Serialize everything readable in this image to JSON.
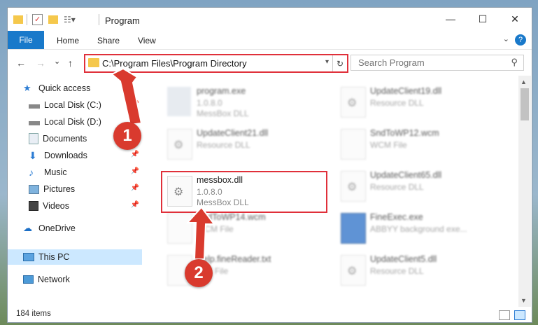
{
  "window": {
    "title": "Program",
    "controls": {
      "minimize": "—",
      "maximize": "☐",
      "close": "✕"
    }
  },
  "ribbon": {
    "file": "File",
    "tabs": [
      "Home",
      "Share",
      "View"
    ],
    "help": "?"
  },
  "nav": {
    "back": "←",
    "forward": "→",
    "recent": "⌄",
    "up": "↑",
    "address": "C:\\Program Files\\Program Directory",
    "search_placeholder": "Search Program"
  },
  "sidebar": {
    "items": [
      {
        "label": "Quick access",
        "icon": "star-icon",
        "pinned": false
      },
      {
        "label": "Local Disk (C:)",
        "icon": "drive-icon",
        "pinned": true
      },
      {
        "label": "Local Disk (D:)",
        "icon": "drive-icon",
        "pinned": true
      },
      {
        "label": "Documents",
        "icon": "documents-icon",
        "pinned": true
      },
      {
        "label": "Downloads",
        "icon": "downloads-icon",
        "pinned": true
      },
      {
        "label": "Music",
        "icon": "music-icon",
        "pinned": true
      },
      {
        "label": "Pictures",
        "icon": "pictures-icon",
        "pinned": true
      },
      {
        "label": "Videos",
        "icon": "videos-icon",
        "pinned": true
      },
      {
        "label": "OneDrive",
        "icon": "cloud-icon",
        "pinned": false
      },
      {
        "label": "This PC",
        "icon": "computer-icon",
        "pinned": false,
        "selected": true
      },
      {
        "label": "Network",
        "icon": "network-icon",
        "pinned": false
      }
    ]
  },
  "files": [
    {
      "name": "program.exe",
      "line1": "1.0.8.0",
      "line2": "MessBox DLL",
      "kind": "exe"
    },
    {
      "name": "UpdateClient19.dll",
      "line1": "Resource DLL",
      "line2": "",
      "kind": "dll"
    },
    {
      "name": "UpdateClient21.dll",
      "line1": "Resource DLL",
      "line2": "",
      "kind": "dll"
    },
    {
      "name": "SndToWP12.wcm",
      "line1": "WCM File",
      "line2": "",
      "kind": "file"
    },
    {
      "name": "messbox.dll",
      "line1": "1.0.8.0",
      "line2": "MessBox DLL",
      "kind": "dll"
    },
    {
      "name": "UpdateClient65.dll",
      "line1": "Resource DLL",
      "line2": "",
      "kind": "dll"
    },
    {
      "name": "SndToWP14.wcm",
      "line1": "WCM File",
      "line2": "",
      "kind": "file"
    },
    {
      "name": "FineExec.exe",
      "line1": "ABBYY background exe...",
      "line2": "",
      "kind": "exe"
    },
    {
      "name": "Help.fineReader.txt",
      "line1": "TXT File",
      "line2": "",
      "kind": "file"
    },
    {
      "name": "UpdateClient5.dll",
      "line1": "Resource DLL",
      "line2": "",
      "kind": "dll"
    }
  ],
  "status": {
    "count": "184 items"
  },
  "callouts": {
    "first": "1",
    "second": "2"
  },
  "colors": {
    "accent": "#1979ca",
    "highlight": "#e0303a",
    "callout": "#d93a2e",
    "selected": "#cce8ff"
  }
}
